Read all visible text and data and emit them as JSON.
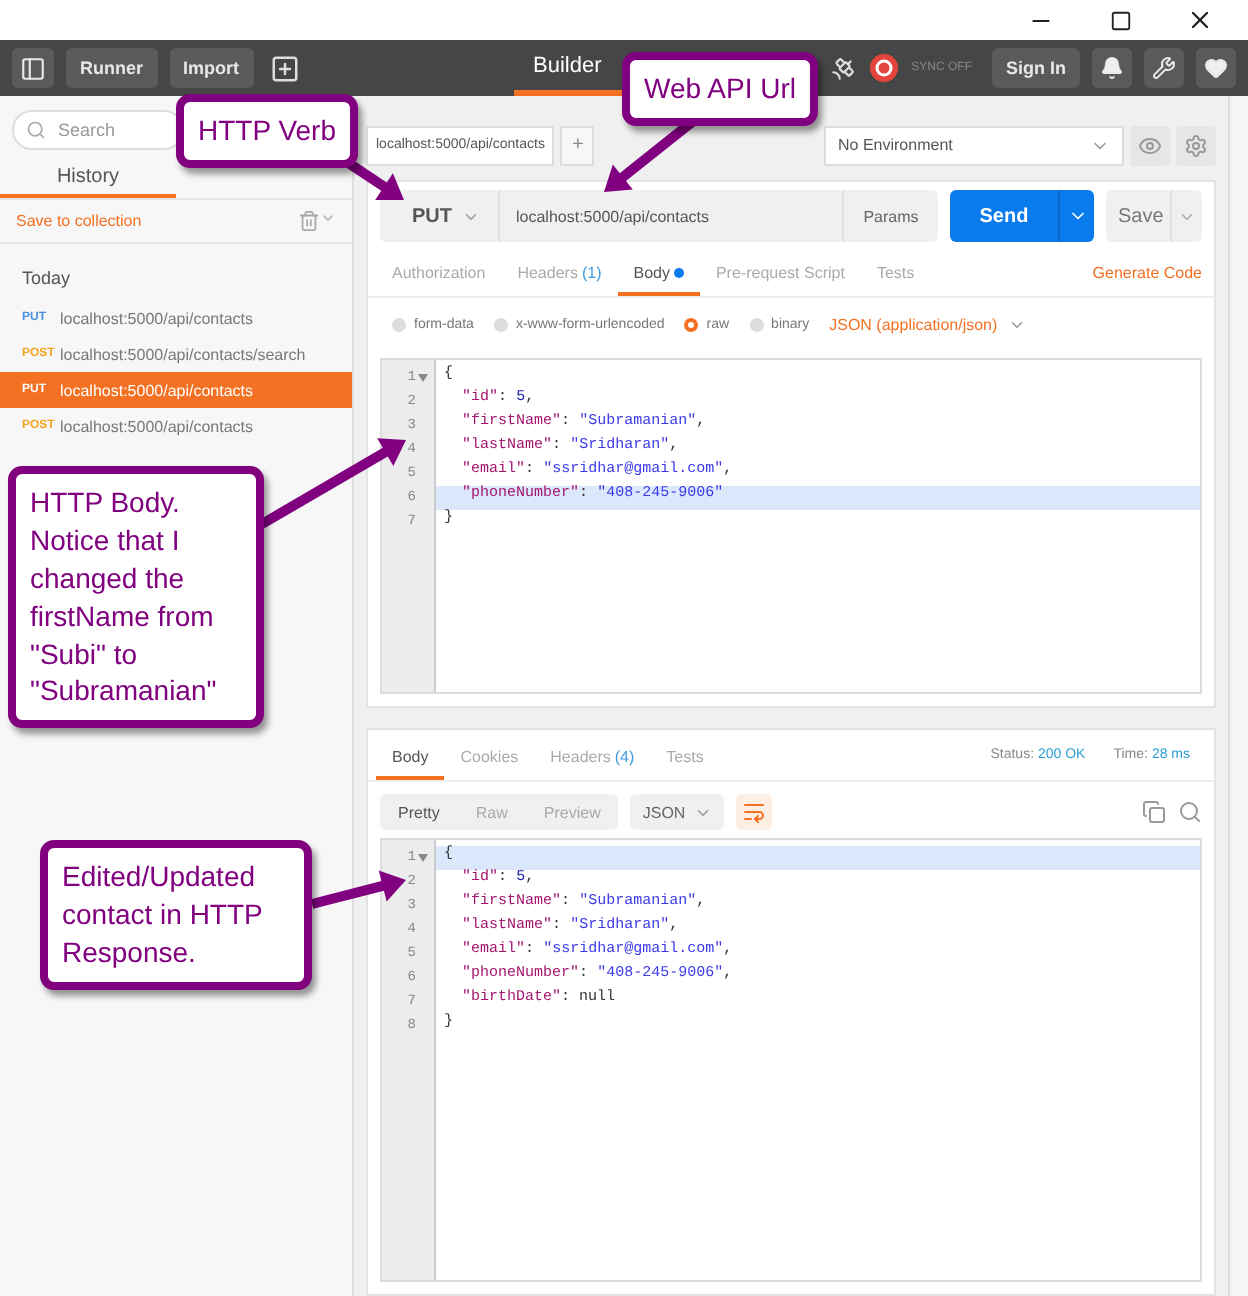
{
  "toolbar": {
    "buttons": [
      "Runner",
      "Import"
    ],
    "tabs": [
      {
        "label": "Builder",
        "selected": true
      }
    ],
    "sync": "SYNC OFF",
    "sign_in": "Sign In"
  },
  "sidebar": {
    "search": {
      "placeholder": "Search"
    },
    "tabs": [
      {
        "label": "History",
        "selected": true
      }
    ],
    "save_link": "Save to collection",
    "group": "Today",
    "items": [
      {
        "method": "PUT",
        "kind": "put",
        "url": "localhost:5000/api/contacts",
        "selected": false
      },
      {
        "method": "POST",
        "kind": "post",
        "url": "localhost:5000/api/contacts/search",
        "selected": false
      },
      {
        "method": "PUT",
        "kind": "put",
        "url": "localhost:5000/api/contacts",
        "selected": true
      },
      {
        "method": "POST",
        "kind": "post",
        "url": "localhost:5000/api/contacts",
        "selected": false
      }
    ]
  },
  "open_tabs": [
    {
      "label": "localhost:5000/api/contacts"
    }
  ],
  "new_tab": "+",
  "environment": "No Environment",
  "request": {
    "method": "PUT",
    "url": "localhost:5000/api/contacts",
    "params": "Params",
    "send": "Send",
    "save": "Save"
  },
  "request_sections": [
    {
      "label": "Authorization",
      "selected": false,
      "dot": false
    },
    {
      "label": "Headers",
      "count": "(1)",
      "selected": false,
      "dot": false
    },
    {
      "label": "Body",
      "selected": true,
      "dot": true
    },
    {
      "label": "Pre-request Script",
      "selected": false,
      "dot": false
    },
    {
      "label": "Tests",
      "selected": false,
      "dot": false
    }
  ],
  "generate_code": "Generate Code",
  "body_modes": [
    {
      "label": "form-data",
      "selected": false
    },
    {
      "label": "x-www-form-urlencoded",
      "selected": false
    },
    {
      "label": "raw",
      "selected": true
    },
    {
      "label": "binary",
      "selected": false
    }
  ],
  "content_type": "JSON (application/json)",
  "request_body": [
    {
      "number": "1",
      "text": "{",
      "highlighted": false,
      "foldable": true
    },
    {
      "number": "2",
      "text": "  \"id\": 5,",
      "highlighted": false,
      "foldable": false
    },
    {
      "number": "3",
      "text": "  \"firstName\": \"Subramanian\",",
      "highlighted": false,
      "foldable": false
    },
    {
      "number": "4",
      "text": "  \"lastName\": \"Sridharan\",",
      "highlighted": false,
      "foldable": false
    },
    {
      "number": "5",
      "text": "  \"email\": \"ssridhar@gmail.com\",",
      "highlighted": false,
      "foldable": false
    },
    {
      "number": "6",
      "text": "  \"phoneNumber\": \"408-245-9006\"",
      "highlighted": true,
      "foldable": false
    },
    {
      "number": "7",
      "text": "}",
      "highlighted": false,
      "foldable": false
    }
  ],
  "response": {
    "tabs": [
      {
        "label": "Body",
        "selected": true
      },
      {
        "label": "Cookies",
        "selected": false
      },
      {
        "label": "Headers",
        "count": "(4)",
        "selected": false
      },
      {
        "label": "Tests",
        "selected": false
      }
    ],
    "status_label": "Status:",
    "status": "200 OK",
    "time_label": "Time:",
    "time": "28 ms",
    "views": [
      {
        "label": "Pretty",
        "selected": true
      },
      {
        "label": "Raw",
        "selected": false
      },
      {
        "label": "Preview",
        "selected": false
      }
    ],
    "format": "JSON",
    "wrap": true,
    "body": [
      {
        "number": "1",
        "text": "{",
        "highlighted": true,
        "foldable": true
      },
      {
        "number": "2",
        "text": "  \"id\": 5,",
        "highlighted": false,
        "foldable": false
      },
      {
        "number": "3",
        "text": "  \"firstName\": \"Subramanian\",",
        "highlighted": false,
        "foldable": false
      },
      {
        "number": "4",
        "text": "  \"lastName\": \"Sridharan\",",
        "highlighted": false,
        "foldable": false
      },
      {
        "number": "5",
        "text": "  \"email\": \"ssridhar@gmail.com\",",
        "highlighted": false,
        "foldable": false
      },
      {
        "number": "6",
        "text": "  \"phoneNumber\": \"408-245-9006\",",
        "highlighted": false,
        "foldable": false
      },
      {
        "number": "7",
        "text": "  \"birthDate\": null",
        "highlighted": false,
        "foldable": false
      },
      {
        "number": "8",
        "text": "}",
        "highlighted": false,
        "foldable": false
      }
    ]
  },
  "callouts": [
    {
      "text": "HTTP Verb"
    },
    {
      "text": "Web API Url"
    },
    {
      "text": "HTTP Body. Notice that I changed the firstName from \"Subi\" to \"Subramanian\""
    },
    {
      "text": "Edited/Updated contact in HTTP Response."
    }
  ]
}
